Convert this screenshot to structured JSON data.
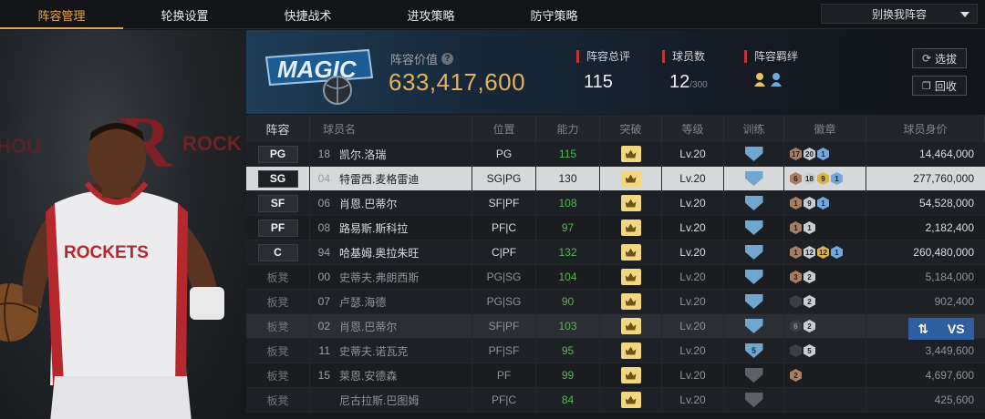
{
  "nav": {
    "tabs": [
      {
        "label": "阵容管理",
        "active": true
      },
      {
        "label": "轮换设置",
        "active": false
      },
      {
        "label": "快捷战术",
        "active": false
      },
      {
        "label": "进攻策略",
        "active": false
      },
      {
        "label": "防守策略",
        "active": false
      }
    ],
    "lineup_select": "别换我阵容"
  },
  "header": {
    "value_label": "阵容价值",
    "value_number": "633,417,600",
    "total_rating_label": "阵容总评",
    "total_rating": "115",
    "player_count_label": "球员数",
    "player_count": "12",
    "player_count_max": "/300",
    "bond_label": "阵容羁绊",
    "btn_select": "选拔",
    "btn_recycle": "回收",
    "team_logo_text": "MAGIC"
  },
  "table": {
    "headers": [
      "阵容",
      "球员名",
      "位置",
      "能力",
      "突破",
      "等级",
      "训练",
      "徽章",
      "球员身价"
    ],
    "rows": [
      {
        "slot": "PG",
        "num": "18",
        "name": "凯尔.洛瑞",
        "position": "PG",
        "ability": "115",
        "level": "Lv.20",
        "badges": [
          [
            "17",
            "b-bronze"
          ],
          [
            "20",
            "b-silver"
          ],
          [
            "1",
            "b-blue"
          ]
        ],
        "salary": "14,464,000"
      },
      {
        "slot": "SG",
        "num": "04",
        "name": "特雷西.麦格雷迪",
        "position": "SG|PG",
        "ability": "130",
        "level": "Lv.20",
        "badges": [
          [
            "6",
            "b-bronze"
          ],
          [
            "18",
            "b-silver"
          ],
          [
            "9",
            "b-gold"
          ],
          [
            "1",
            "b-blue"
          ]
        ],
        "salary": "277,760,000"
      },
      {
        "slot": "SF",
        "num": "06",
        "name": "肖恩.巴蒂尔",
        "position": "SF|PF",
        "ability": "108",
        "level": "Lv.20",
        "badges": [
          [
            "1",
            "b-bronze"
          ],
          [
            "9",
            "b-silver"
          ],
          [
            "1",
            "b-blue"
          ]
        ],
        "salary": "54,528,000"
      },
      {
        "slot": "PF",
        "num": "08",
        "name": "路易斯.斯科拉",
        "position": "PF|C",
        "ability": "97",
        "level": "Lv.20",
        "badges": [
          [
            "1",
            "b-bronze"
          ],
          [
            "1",
            "b-silver"
          ]
        ],
        "salary": "2,182,400"
      },
      {
        "slot": "C",
        "num": "94",
        "name": "哈基姆.奥拉朱旺",
        "position": "C|PF",
        "ability": "132",
        "level": "Lv.20",
        "badges": [
          [
            "1",
            "b-bronze"
          ],
          [
            "12",
            "b-silver"
          ],
          [
            "12",
            "b-gold"
          ],
          [
            "1",
            "b-blue"
          ]
        ],
        "salary": "260,480,000"
      },
      {
        "slot": "板凳",
        "num": "00",
        "name": "史蒂夫.弗朗西斯",
        "position": "PG|SG",
        "ability": "104",
        "level": "Lv.20",
        "badges": [
          [
            "3",
            "b-bronze"
          ],
          [
            "2",
            "b-silver"
          ]
        ],
        "salary": "5,184,000"
      },
      {
        "slot": "板凳",
        "num": "07",
        "name": "卢瑟.海德",
        "position": "PG|SG",
        "ability": "90",
        "level": "Lv.20",
        "badges": [
          [
            "",
            "b-dark"
          ],
          [
            "2",
            "b-silver"
          ]
        ],
        "salary": "902,400"
      },
      {
        "slot": "板凳",
        "num": "02",
        "name": "肖恩.巴蒂尔",
        "position": "SF|PF",
        "ability": "103",
        "level": "Lv.20",
        "badges": [
          [
            "6",
            "b-dark"
          ],
          [
            "2",
            "b-silver"
          ]
        ],
        "salary": ""
      },
      {
        "slot": "板凳",
        "num": "11",
        "name": "史蒂夫.诺瓦克",
        "position": "PF|SF",
        "ability": "95",
        "level": "Lv.20",
        "train": "5",
        "badges": [
          [
            "",
            "b-dark"
          ],
          [
            "5",
            "b-silver"
          ]
        ],
        "salary": "3,449,600"
      },
      {
        "slot": "板凳",
        "num": "15",
        "name": "莱恩.安德森",
        "position": "PF",
        "ability": "99",
        "level": "Lv.20",
        "badges": [
          [
            "2",
            "b-bronze"
          ]
        ],
        "salary": "4,697,600"
      },
      {
        "slot": "板凳",
        "num": "",
        "name": "尼古拉斯.巴图姆",
        "position": "PF|C",
        "ability": "84",
        "level": "Lv.20",
        "badges": [],
        "salary": "425,600"
      }
    ]
  },
  "vs_button": "VS",
  "colors": {
    "accent": "#e8a64a",
    "value_gold": "#e3b35c",
    "ability_green": "#59b45a",
    "vs_blue": "#2f5f9e"
  }
}
